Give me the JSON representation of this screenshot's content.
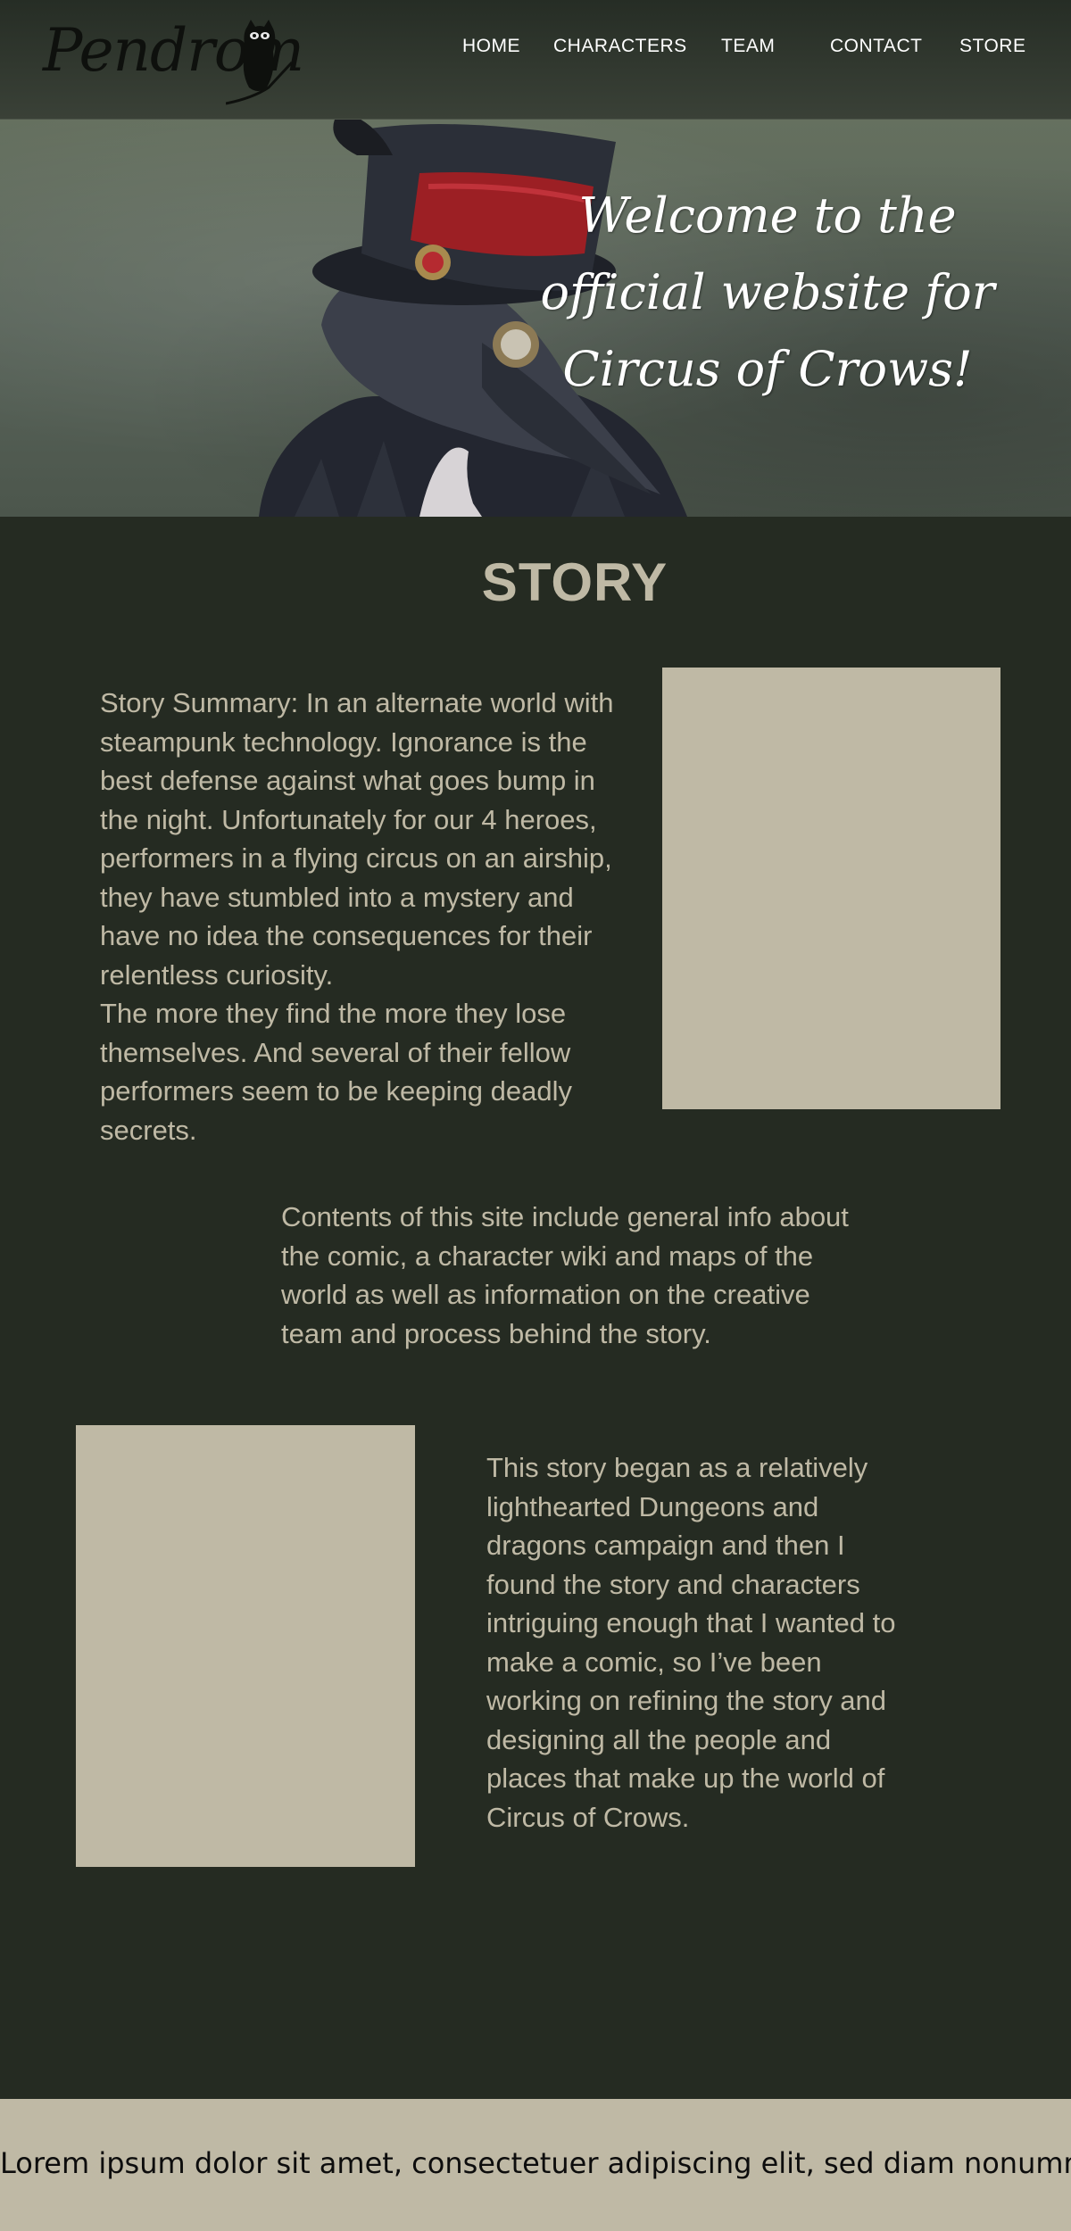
{
  "header": {
    "logo_text": "Pendrom",
    "logo_icon": "owl-icon",
    "nav": [
      {
        "label": "HOME"
      },
      {
        "label": "CHARACTERS"
      },
      {
        "label": "TEAM"
      },
      {
        "label": "CONTACT"
      },
      {
        "label": "STORE"
      }
    ]
  },
  "hero": {
    "title": "Welcome to the official website for Circus of Crows!",
    "image": "plague-doctor-crow-character-illustration"
  },
  "main": {
    "heading": "STORY",
    "summary": "Story Summary: In an alternate world with steampunk technology. Ignorance is the best defense against what goes bump in the night. Unfortunately for our 4 heroes, performers in a flying circus on an airship, they have stumbled into a mystery and have no idea the consequences for their relentless curiosity.\n  The more they find the more they lose themselves. And several of their fellow performers seem to be keeping deadly secrets.",
    "contents": "Contents of this site include general info about the comic, a character wiki and maps of the world as well as information on the creative team and process behind the story.",
    "origin": "This story began as a relatively lighthearted Dungeons and dragons campaign and then I found the story and characters intriguing enough that I wanted to make a comic, so I’ve been working on refining the story and designing all the people and places that make up the world of Circus of Crows."
  },
  "footer": {
    "text": "Lorem ipsum dolor sit amet, consectetuer adipiscing elit, sed diam nonummy"
  },
  "colors": {
    "background": "#252b22",
    "accent_text": "#bfb9a5",
    "header_bg": "#343b32",
    "footer_bg": "#bfb9a5"
  }
}
